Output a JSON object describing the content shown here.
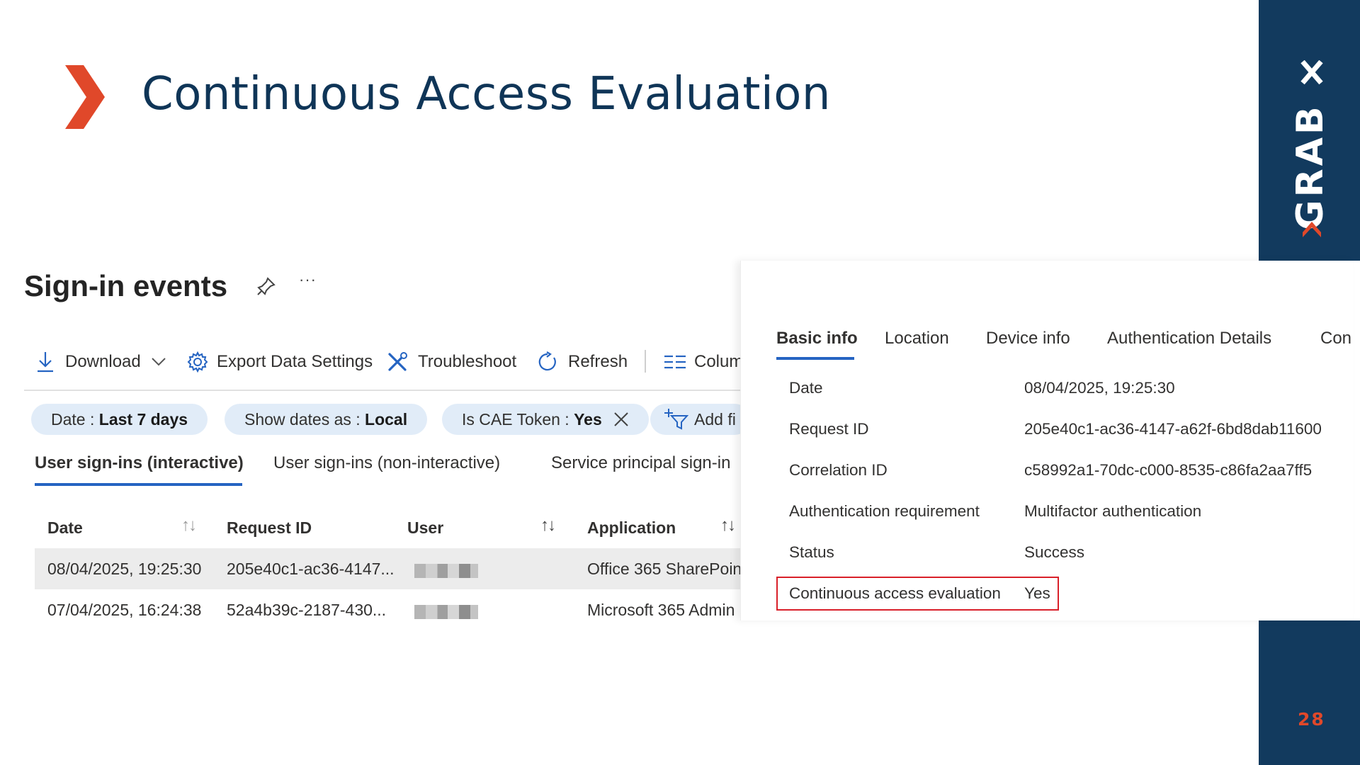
{
  "slide": {
    "title": "Continuous Access Evaluation",
    "page_number": "28",
    "brand": "GRABX",
    "colors": {
      "navy": "#123a5e",
      "accent": "#e0482a",
      "title": "#0f3557",
      "highlight": "#d9202a",
      "link": "#2564c2"
    }
  },
  "signins": {
    "title": "Sign-in events",
    "toolbar": {
      "download": "Download",
      "export": "Export Data Settings",
      "troubleshoot": "Troubleshoot",
      "refresh": "Refresh",
      "columns": "Colum"
    },
    "filters": {
      "date_label": "Date : ",
      "date_value": "Last 7 days",
      "show_dates_label": "Show dates as : ",
      "show_dates_value": "Local",
      "cae_label": "Is CAE Token : ",
      "cae_value": "Yes",
      "add_filter": "Add fi"
    },
    "tabs": [
      "User sign-ins (interactive)",
      "User sign-ins (non-interactive)",
      "Service principal sign-in"
    ],
    "columns": [
      "Date",
      "Request ID",
      "User",
      "Application"
    ],
    "rows": [
      {
        "date": "08/04/2025, 19:25:30",
        "request_id": "205e40c1-ac36-4147...",
        "application": "Office 365 SharePoin"
      },
      {
        "date": "07/04/2025, 16:24:38",
        "request_id": "52a4b39c-2187-430...",
        "application": "Microsoft 365 Admin"
      }
    ]
  },
  "details": {
    "tabs": [
      "Basic info",
      "Location",
      "Device info",
      "Authentication Details",
      "Con"
    ],
    "fields": [
      {
        "label": "Date",
        "value": "08/04/2025, 19:25:30"
      },
      {
        "label": "Request ID",
        "value": "205e40c1-ac36-4147-a62f-6bd8dab11600"
      },
      {
        "label": "Correlation ID",
        "value": "c58992a1-70dc-c000-8535-c86fa2aa7ff5"
      },
      {
        "label": "Authentication requirement",
        "value": "Multifactor authentication"
      },
      {
        "label": "Status",
        "value": "Success"
      },
      {
        "label": "Continuous access evaluation",
        "value": "Yes"
      }
    ]
  }
}
